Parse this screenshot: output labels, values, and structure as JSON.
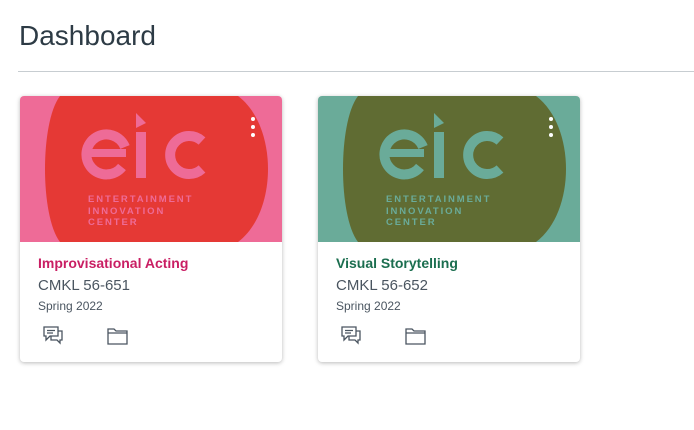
{
  "page": {
    "title": "Dashboard"
  },
  "cards": [
    {
      "course_name": "Improvisational Acting",
      "course_code": "CMKL 56-651",
      "term": "Spring 2022",
      "brand_text": [
        "ENTERTAINMENT",
        "INNOVATION",
        "CENTER"
      ],
      "logo_mark": "eic",
      "icons": [
        "discussions-icon",
        "files-icon",
        "more-options-icon"
      ],
      "colors": {
        "outer": "#ee6b97",
        "inner": "#e53935",
        "mark": "#ee6b97",
        "accent": "#c91e63"
      }
    },
    {
      "course_name": "Visual Storytelling",
      "course_code": "CMKL 56-652",
      "term": "Spring 2022",
      "brand_text": [
        "ENTERTAINMENT",
        "INNOVATION",
        "CENTER"
      ],
      "logo_mark": "eic",
      "icons": [
        "discussions-icon",
        "files-icon",
        "more-options-icon"
      ],
      "colors": {
        "outer": "#6aab99",
        "inner": "#606c33",
        "mark": "#6aab99",
        "accent": "#1b6e4f"
      }
    }
  ]
}
